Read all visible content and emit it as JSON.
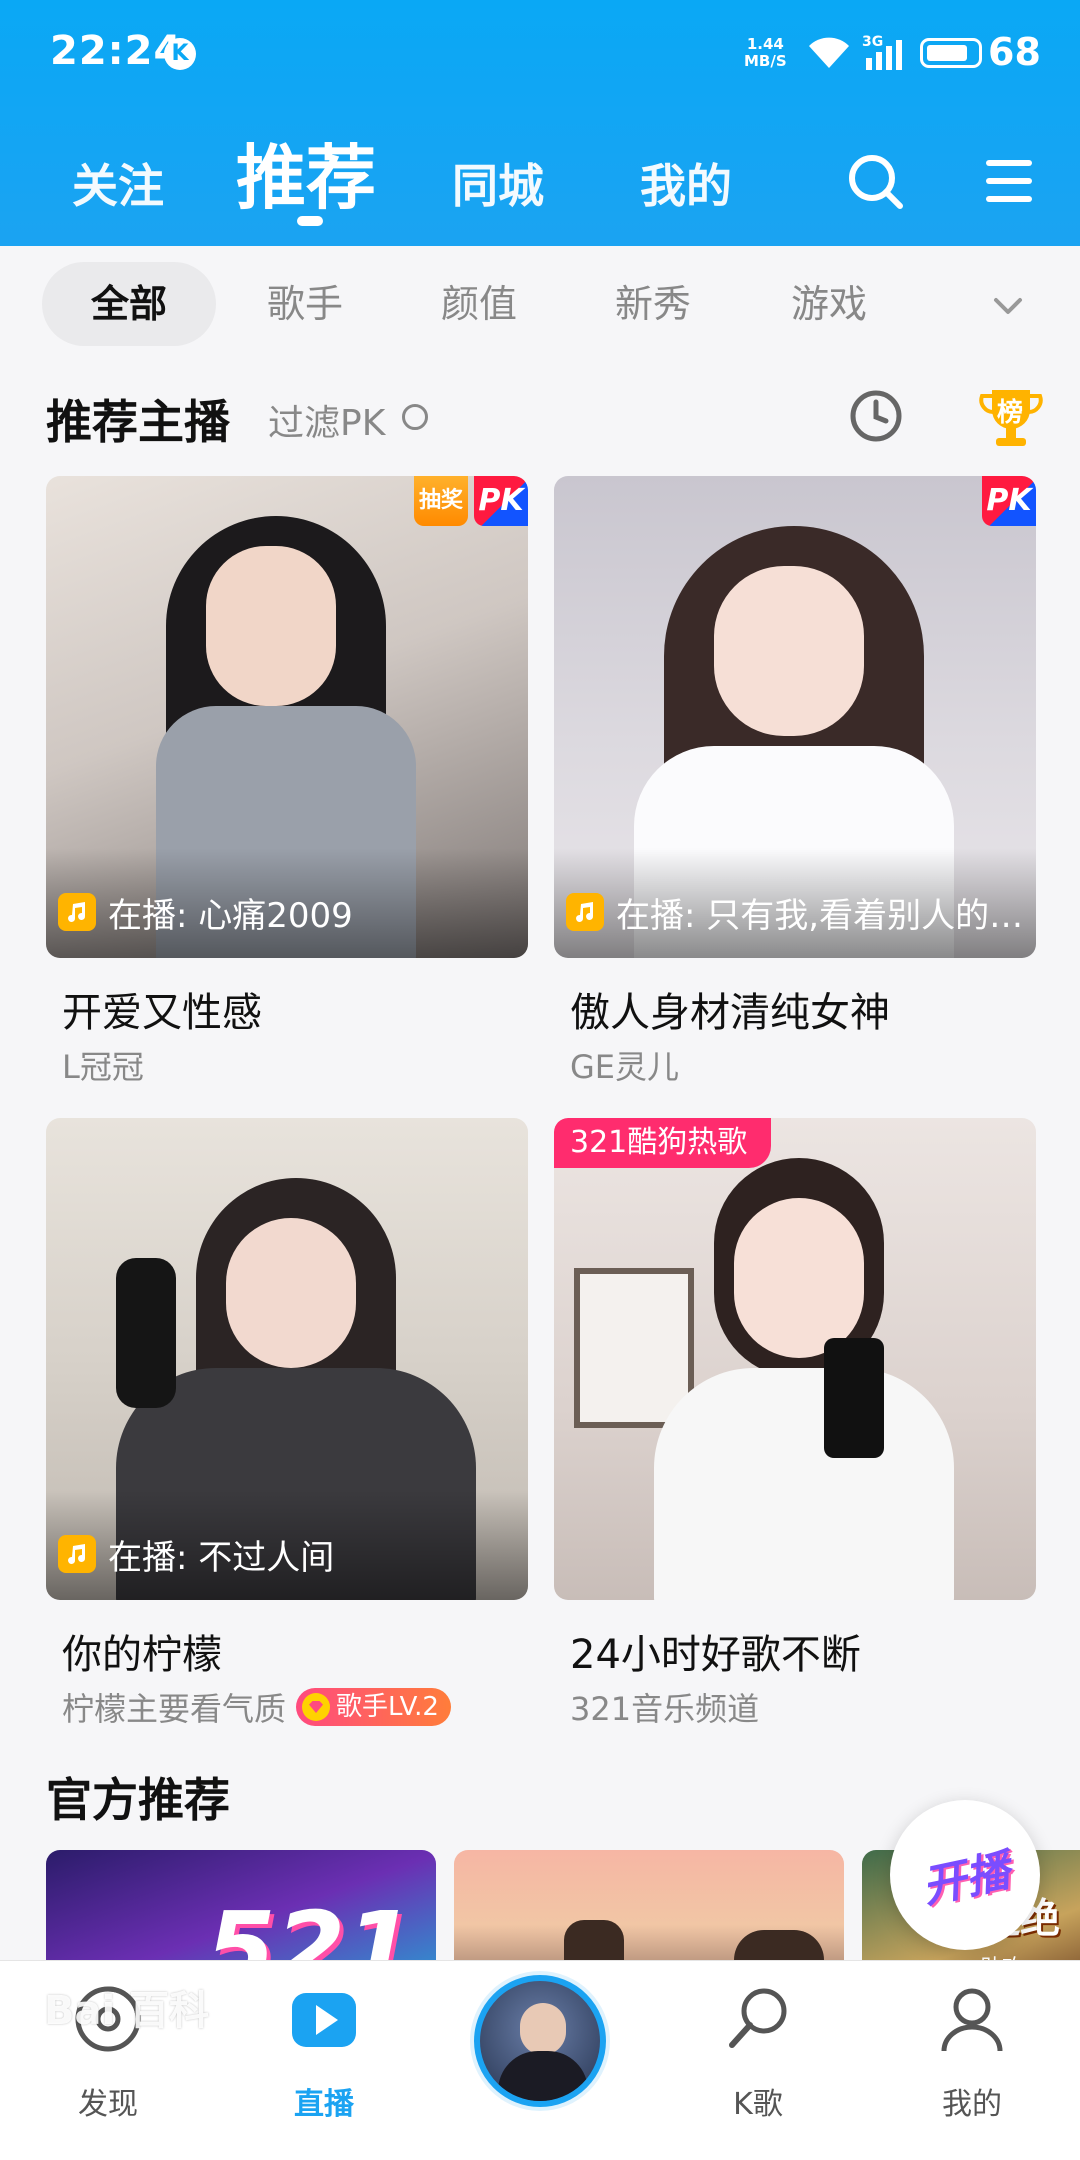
{
  "status": {
    "time": "22:24",
    "k_badge": "K",
    "speed": "1.44",
    "speed_unit": "MB/S",
    "network": "3G",
    "battery": "68"
  },
  "topnav": {
    "follow": "关注",
    "recommend": "推荐",
    "nearby": "同城",
    "mine": "我的"
  },
  "categories": {
    "all": "全部",
    "singer": "歌手",
    "looks": "颜值",
    "newcomer": "新秀",
    "game": "游戏"
  },
  "recommended": {
    "title": "推荐主播",
    "filter": "过滤PK",
    "cards": [
      {
        "playing": "在播: 心痛2009",
        "title": "开爱又性感",
        "host": "L冠冠",
        "badge_lottery": "抽奖",
        "badge_pk": "PK"
      },
      {
        "playing": "在播: 只有我,看着别人的快乐",
        "title": "傲人身材清纯女神",
        "host": "GE灵儿",
        "badge_pk": "PK"
      },
      {
        "playing": "在播: 不过人间",
        "title": "你的柠檬",
        "host": "柠檬主要看气质",
        "singer_badge": "歌手LV.2"
      },
      {
        "title": "24小时好歌不断",
        "host": "321音乐频道",
        "badge_kugou": "321酷狗热歌"
      }
    ],
    "trophy_label": "榜"
  },
  "official": {
    "title": "官方推荐",
    "card1_text": "521",
    "card3_text": "连绝",
    "card3_sub": "助攻"
  },
  "start_live": "开播",
  "bottom_tabs": {
    "discover": "发现",
    "live": "直播",
    "ksong": "K歌",
    "me": "我的"
  },
  "watermark": "Bai 百科",
  "colors": {
    "brand_blue": "#1ba3f2",
    "pink": "#ff2c6e",
    "orange": "#ffb400"
  }
}
